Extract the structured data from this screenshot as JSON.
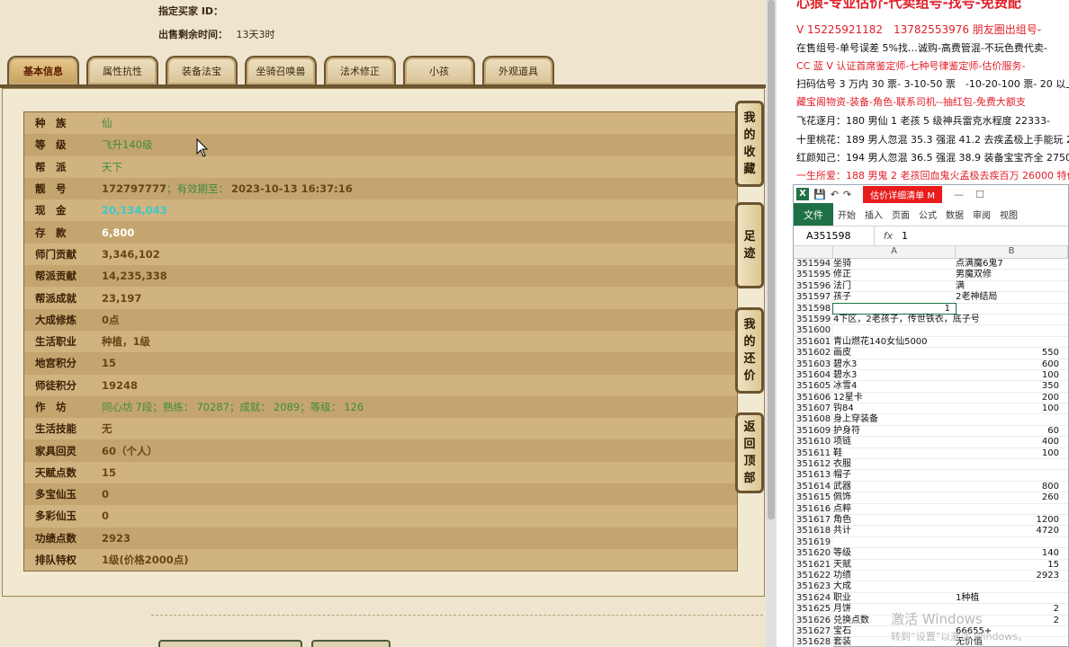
{
  "top_info": {
    "buyer_label": "指定买家 ID：",
    "buyer_value": "",
    "time_label": "出售剩余时间：",
    "time_value": "13天3时"
  },
  "tabs": [
    "基本信息",
    "属性抗性",
    "装备法宝",
    "坐骑召唤兽",
    "法术修正",
    "小孩",
    "外观道具"
  ],
  "attributes": [
    {
      "k": "种　族",
      "v": "仙",
      "style": "green"
    },
    {
      "k": "等　级",
      "v": "飞升140级",
      "style": "green"
    },
    {
      "k": "帮　派",
      "v": "天下",
      "style": "green"
    },
    {
      "k": "靓　号",
      "v": "172797777",
      "style": "brown",
      "extra_sep": "；有效期至：",
      "extra": "2023-10-13 16:37:16"
    },
    {
      "k": "现　金",
      "v": "20,134,043",
      "style": "teal"
    },
    {
      "k": "存　款",
      "v": "6,800",
      "style": "white"
    },
    {
      "k": "师门贡献",
      "v": "3,346,102",
      "style": "brown"
    },
    {
      "k": "帮派贡献",
      "v": "14,235,338",
      "style": "brown"
    },
    {
      "k": "帮派成就",
      "v": "23,197",
      "style": "brown"
    },
    {
      "k": "大成修炼",
      "v": "0点",
      "style": "brown"
    },
    {
      "k": "生活职业",
      "v": "种植，1级",
      "style": "brown"
    },
    {
      "k": "地宫积分",
      "v": "15",
      "style": "brown"
    },
    {
      "k": "师徒积分",
      "v": "19248",
      "style": "brown"
    },
    {
      "k": "作　坊",
      "v": "同心坊",
      "style": "green",
      "extra": "7",
      "extra_sep": "段；熟练：",
      "extra2": "70287",
      "extra2_sep": "；成就：",
      "extra3": "2089",
      "extra3_sep": "；等级：",
      "extra4": "126"
    },
    {
      "k": "生活技能",
      "v": "无",
      "style": "brown"
    },
    {
      "k": "家具回灵",
      "v": "60（个人）",
      "style": "brown"
    },
    {
      "k": "天赋点数",
      "v": "15",
      "style": "brown"
    },
    {
      "k": "多宝仙玉",
      "v": "0",
      "style": "brown"
    },
    {
      "k": "多彩仙玉",
      "v": "0",
      "style": "brown"
    },
    {
      "k": "功绩点数",
      "v": "2923",
      "style": "brown"
    },
    {
      "k": "排队特权",
      "v": "1级(价格2000点)",
      "style": "brown"
    }
  ],
  "side_buttons": [
    {
      "label": "我的收藏",
      "chars": [
        "我",
        "的",
        "收",
        "藏"
      ]
    },
    {
      "label": "足迹",
      "chars": [
        "足",
        "迹"
      ]
    },
    {
      "label": "我的还价",
      "chars": [
        "我",
        "的",
        "还",
        "价"
      ]
    },
    {
      "label": "返回顶部",
      "chars": [
        "返",
        "回",
        "顶",
        "部"
      ]
    }
  ],
  "ads": {
    "title": "心狼-专业估价-代卖组号-找号-免费配",
    "line1": "V 15225921182　13782553976 朋友圈出组号-",
    "line2": "在售组号-单号误差 5%找…诚购-高费管混-不玩色费代卖-",
    "line3": "CC 蓝 V 认证首席鉴定师-七种号律鉴定师-估价服务-",
    "line4": "扫码估号 3 万内 30 票- 3-10-50 票　-10-20-100 票- 20 以上 150",
    "line5": "藏宝阁物资-装备-角色-联系司机--抽红包-免费大额支",
    "line6": "飞花逐月：180 男仙 1 老孩 5 级神兵雷克水程度 22333-",
    "line7": "十里桃花：189 男人忽混 35.3 强混 41.2 去疾孟极上手能玩 2",
    "line8": "红颜知己：194 男人忽混 36.5 强混 38.9 装备宝宝齐全 27500",
    "line9": "一生所爱：188 男鬼 2 老孩回血鬼火孟极去疾百万 26000 特价"
  },
  "excel": {
    "title": "估价详细清单 M",
    "ribbon_file": "文件",
    "ribbon_tabs": [
      "开始",
      "插入",
      "页面",
      "公式",
      "数据",
      "审阅",
      "视图"
    ],
    "namebox": "A351598",
    "fx": "fx",
    "formula": "1",
    "col_a": "A",
    "col_b": "B",
    "rows": [
      {
        "n": "351594",
        "a": "坐骑",
        "b": "点满魔6鬼7",
        "num": false
      },
      {
        "n": "351595",
        "a": "修正",
        "b": "男魔双修",
        "num": false
      },
      {
        "n": "351596",
        "a": "法门",
        "b": "满",
        "num": false
      },
      {
        "n": "351597",
        "a": "孩子",
        "b": "2老神结局",
        "num": false
      },
      {
        "n": "351598",
        "a": "1",
        "b": "",
        "num": false
      },
      {
        "n": "351599",
        "a": "4下区，2老孩子，传世铁衣，底子号",
        "b": "",
        "num": false
      },
      {
        "n": "351600",
        "a": "",
        "b": "",
        "num": false
      },
      {
        "n": "351601",
        "a": "青山燃花140女仙5000",
        "b": "",
        "num": false
      },
      {
        "n": "351602",
        "a": "画皮",
        "b": "550",
        "num": true
      },
      {
        "n": "351603",
        "a": "碧水3",
        "b": "600",
        "num": true
      },
      {
        "n": "351604",
        "a": "碧水3",
        "b": "100",
        "num": true
      },
      {
        "n": "351605",
        "a": "冰雪4",
        "b": "350",
        "num": true
      },
      {
        "n": "351606",
        "a": "12星卡",
        "b": "200",
        "num": true
      },
      {
        "n": "351607",
        "a": "钩84",
        "b": "100",
        "num": true
      },
      {
        "n": "351608",
        "a": "身上穿装备",
        "b": "",
        "num": false
      },
      {
        "n": "351609",
        "a": "护身符",
        "b": "60",
        "num": true
      },
      {
        "n": "351610",
        "a": "项链",
        "b": "400",
        "num": true
      },
      {
        "n": "351611",
        "a": "鞋",
        "b": "100",
        "num": true
      },
      {
        "n": "351612",
        "a": "衣服",
        "b": "",
        "num": false
      },
      {
        "n": "351613",
        "a": "帽子",
        "b": "",
        "num": false
      },
      {
        "n": "351614",
        "a": "武器",
        "b": "800",
        "num": true
      },
      {
        "n": "351615",
        "a": "佩饰",
        "b": "260",
        "num": true
      },
      {
        "n": "351616",
        "a": "点粹",
        "b": "",
        "num": false
      },
      {
        "n": "351617",
        "a": "角色",
        "b": "1200",
        "num": true
      },
      {
        "n": "351618",
        "a": "共计",
        "b": "4720",
        "num": true
      },
      {
        "n": "351619",
        "a": "",
        "b": "",
        "num": false
      },
      {
        "n": "351620",
        "a": "等级",
        "b": "140",
        "num": true
      },
      {
        "n": "351621",
        "a": "天赋",
        "b": "15",
        "num": true
      },
      {
        "n": "351622",
        "a": "功绩",
        "b": "2923",
        "num": true
      },
      {
        "n": "351623",
        "a": "大成",
        "b": "",
        "num": false
      },
      {
        "n": "351624",
        "a": "职业",
        "b": "1种植",
        "num": false
      },
      {
        "n": "351625",
        "a": "月饼",
        "b": "2",
        "num": true
      },
      {
        "n": "351626",
        "a": "兑换点数",
        "b": "2",
        "num": true
      },
      {
        "n": "351627",
        "a": "宝石",
        "b": "66655+",
        "num": false
      },
      {
        "n": "351628",
        "a": "套装",
        "b": "无价值",
        "num": false
      }
    ]
  },
  "watermark": {
    "line1": "激活 Windows",
    "line2": "转到“设置”以激活 Windows。"
  }
}
